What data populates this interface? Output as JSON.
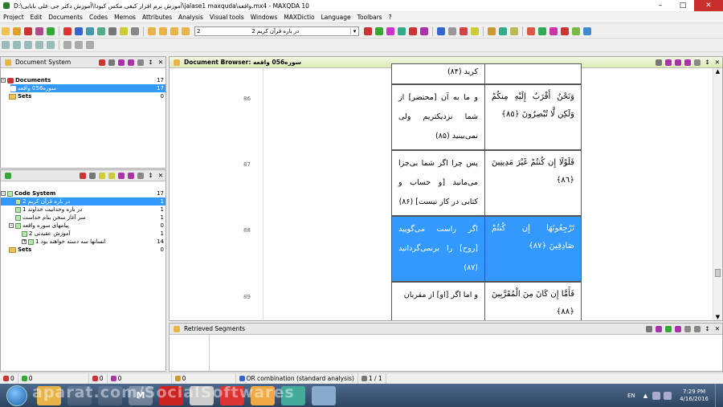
{
  "window": {
    "title": "D:\\آموزش نرم افزار کیفی مکس کیودا\\آموزش دکتر جی علی بابایی\\jalase1 maxquda\\واقعه.mx4 - MAXQDA 10"
  },
  "menu": [
    "Project",
    "Edit",
    "Documents",
    "Codes",
    "Memos",
    "Attributes",
    "Analysis",
    "Visual tools",
    "Windows",
    "MAXDictio",
    "Language",
    "Toolbars",
    "?"
  ],
  "toolbar": {
    "code_combo_number": "2",
    "code_combo_value": "در باره قرآن کریم 2"
  },
  "document_system": {
    "title": "Document System",
    "items": [
      {
        "label": "Documents",
        "count": "17"
      },
      {
        "label": "سوره056 واقعه",
        "count": "17"
      },
      {
        "label": "Sets",
        "count": "0"
      }
    ]
  },
  "code_system": {
    "title": "Code System",
    "items": [
      {
        "label": "Code System",
        "count": "17"
      },
      {
        "label": "در باره قرآن کریم 2",
        "count": "1"
      },
      {
        "label": "در باره وحدانیت خداوند 1",
        "count": "1"
      },
      {
        "label": "سر آغاز سخن بنام خداست",
        "count": "1"
      },
      {
        "label": "پیامهای سوره واقعه",
        "count": "0"
      },
      {
        "label": "آموزش عقیدتی 2",
        "count": "1"
      },
      {
        "label": "انسانها سه دسته خواهند بود 1",
        "count": "14"
      },
      {
        "label": "Sets",
        "count": "0"
      }
    ]
  },
  "document_browser": {
    "title": "Document Browser: سوره056 واقعه",
    "rows": [
      {
        "num": "",
        "fa": "کرید (۸۴)",
        "ar": ""
      },
      {
        "num": "86",
        "fa": "و ما به آن [محتضر] از شما نزدیکتریم ولی نمی‌بینید (۸۵)",
        "ar": "وَنَحْنُ أَقْرَبُ إِلَيْهِ مِنكُمْ وَلَكِن لَّا تُبْصِرُونَ ﴿٨٥﴾"
      },
      {
        "num": "87",
        "fa": "پس چرا اگر شما بی‌جزا می‌مانید [و حساب و کتابی در کار نیست] (۸۶)",
        "ar": "فَلَوْلَا إِن كُنتُمْ غَيْرَ مَدِينِينَ ﴿٨٦﴾"
      },
      {
        "num": "88",
        "fa": "اگر راست می‌گویید [روح] را برنمی‌گردانید (۸۷)",
        "ar": "تَرْجِعُونَهَا إِن كُنتُمْ صَادِقِينَ ﴿٨٧﴾"
      },
      {
        "num": "89",
        "fa": "و اما اگر [او] از مقربان",
        "ar": "فَأَمَّا إِن كَانَ مِنَ الْمُقَرَّبِينَ ﴿٨٨﴾"
      }
    ]
  },
  "retrieved": {
    "title": "Retrieved Segments"
  },
  "status": {
    "s1": "0",
    "s2": "0",
    "s3": "0",
    "s4": "0",
    "s5": "0",
    "combination": "OR combination (standard analysis)",
    "pages": "1 / 1"
  },
  "tray": {
    "lang": "EN",
    "time": "7:29 PM",
    "date": "4/16/2016"
  },
  "watermark": "aparat.com/SocialSoftwares"
}
